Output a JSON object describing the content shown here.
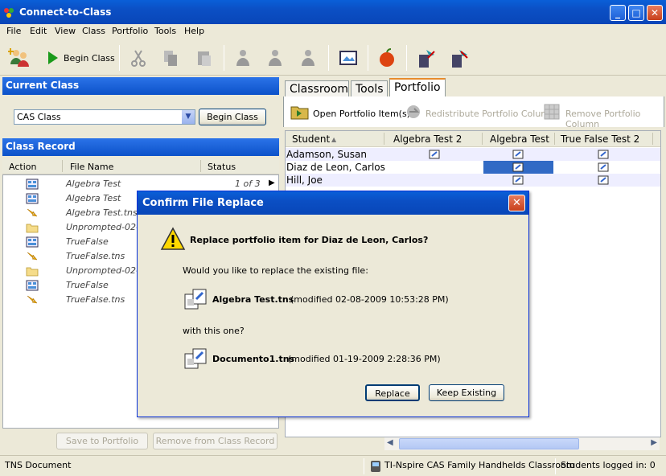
{
  "window": {
    "title": "Connect-to-Class"
  },
  "menu": [
    "File",
    "Edit",
    "View",
    "Class",
    "Portfolio",
    "Tools",
    "Help"
  ],
  "toolbar": {
    "begin_class_label": "Begin Class"
  },
  "current_class": {
    "header": "Current Class",
    "selected": "CAS Class",
    "begin_button": "Begin Class"
  },
  "class_record": {
    "header": "Class Record",
    "columns": [
      "Action",
      "File Name",
      "Status"
    ],
    "rows": [
      {
        "action_icon": "document-icon",
        "file": "Algebra Test",
        "status": "1 of 3"
      },
      {
        "action_icon": "document-icon",
        "file": "Algebra Test",
        "status": ""
      },
      {
        "action_icon": "arrow-icon",
        "file": "Algebra Test.tns",
        "status": ""
      },
      {
        "action_icon": "folder-icon",
        "file": "Unprompted-02-",
        "status": ""
      },
      {
        "action_icon": "document-icon",
        "file": "TrueFalse",
        "status": ""
      },
      {
        "action_icon": "arrow-icon",
        "file": "TrueFalse.tns",
        "status": ""
      },
      {
        "action_icon": "folder-icon",
        "file": "Unprompted-02-",
        "status": ""
      },
      {
        "action_icon": "document-icon",
        "file": "TrueFalse",
        "status": ""
      },
      {
        "action_icon": "arrow-icon",
        "file": "TrueFalse.tns",
        "status": ""
      }
    ],
    "save_button": "Save to Portfolio",
    "remove_button": "Remove from Class Record"
  },
  "tabs": [
    "Classroom",
    "Tools",
    "Portfolio"
  ],
  "active_tab": "Portfolio",
  "portfolio": {
    "open_label": "Open Portfolio Item(s)",
    "redistribute_label": "Redistribute Portfolio Column",
    "remove_label": "Remove Portfolio Column",
    "columns": [
      "Student",
      "Algebra Test 2",
      "Algebra Test",
      "True False Test 2"
    ],
    "students": [
      "Adamson, Susan",
      "Diaz de Leon, Carlos",
      "Hill, Joe"
    ]
  },
  "dialog": {
    "title": "Confirm File Replace",
    "heading": "Replace portfolio item for Diaz de Leon, Carlos?",
    "question": "Would you like to replace the existing file:",
    "existing_file": "Algebra Test.tns",
    "existing_modified": "(modified 02-08-2009 10:53:28 PM)",
    "with_text": "with this one?",
    "new_file": "Documento1.tns",
    "new_modified": "(modified 01-19-2009 2:28:36 PM)",
    "replace_button": "Replace",
    "keep_button": "Keep Existing"
  },
  "status_bar": {
    "left": "TNS Document",
    "network": "TI-Nspire CAS Family Handhelds Classroom",
    "students": "Students logged in:  0"
  }
}
